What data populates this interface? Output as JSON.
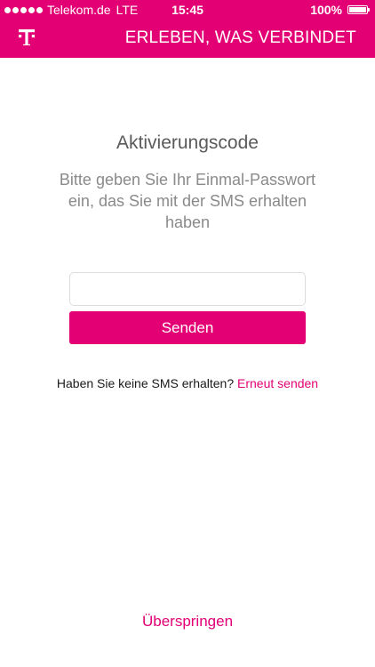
{
  "colors": {
    "brand": "#e20074",
    "title_text": "#5a5a5a",
    "description_text": "#8a8a8a"
  },
  "status_bar": {
    "carrier": "Telekom.de",
    "network": "LTE",
    "time": "15:45",
    "battery_percent": "100%",
    "battery_level": 1.0,
    "signal_bars": 5
  },
  "header": {
    "logo_icon": "telekom-t-logo",
    "tagline": "ERLEBEN, WAS VERBINDET"
  },
  "main": {
    "title": "Aktivierungscode",
    "description": "Bitte geben Sie Ihr Einmal-Passwort ein, das Sie mit der SMS erhalten haben",
    "code_input": {
      "value": "",
      "placeholder": ""
    },
    "send_label": "Senden",
    "resend_question": "Haben Sie keine SMS erhalten?",
    "resend_link": "Erneut senden"
  },
  "footer": {
    "skip_label": "Überspringen"
  }
}
